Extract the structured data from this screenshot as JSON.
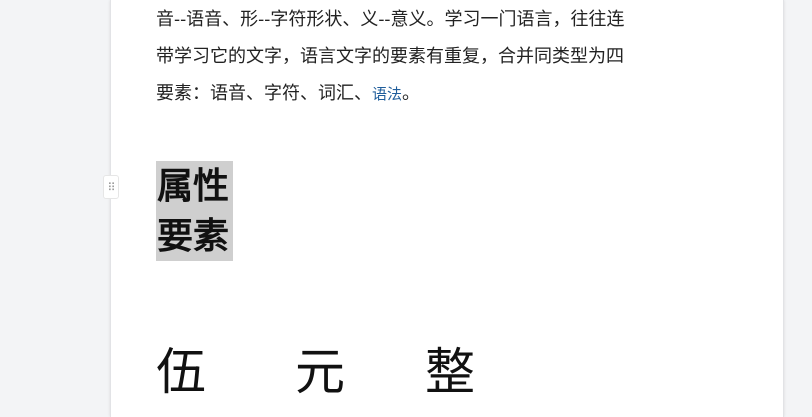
{
  "paragraph": {
    "line1": "音--语音、形--字符形状、义--意义。学习一门语言，往往连",
    "line2": "带学习它的文字，语言文字的要素有重复，合并同类型为四",
    "line3_text": "要素：语音、字符、词汇、",
    "line3_link": "语法",
    "line3_end": "。"
  },
  "heading": {
    "line1": "属性",
    "line2": "要素"
  },
  "amount": {
    "char1": "伍",
    "char2": "元",
    "char3": "整"
  },
  "icons": {
    "drag_handle": "drag-handle-icon"
  },
  "colors": {
    "link": "#1f5d9b",
    "highlight": "#cfcfcf",
    "page_bg": "#ffffff",
    "canvas_bg": "#f3f4f6"
  }
}
